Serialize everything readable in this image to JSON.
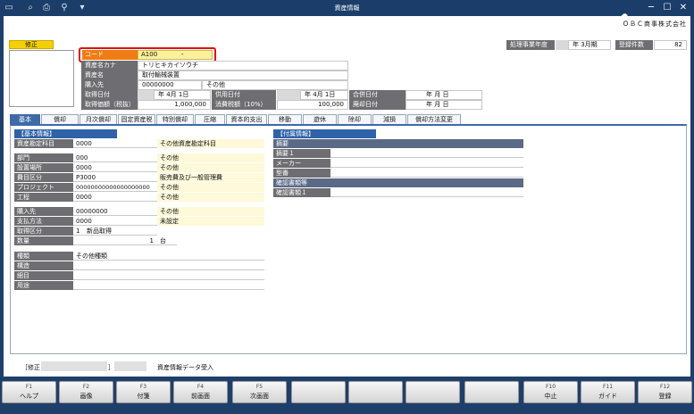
{
  "window": {
    "title": "資産情報"
  },
  "company": "ＯＢＣ商事株式会社",
  "edit_mode": "修正",
  "period": {
    "label": "処理事業年度",
    "value": "年  3月期"
  },
  "registered_count": {
    "label": "登録件数",
    "value": "82"
  },
  "header_fields": {
    "code_label": "コード",
    "code_value": "A100",
    "code_dash": "-",
    "kana_label": "資産名カナ",
    "kana_value": "トリヒキカイソウチ",
    "name_label": "資産名",
    "name_value": "取付輸械装置",
    "purchase_label": "購入先",
    "purchase_code": "00000000",
    "purchase_name": "その他",
    "acq_date_label": "取得日付",
    "acq_date_value": "年  4月  1日",
    "use_date_label": "供用日付",
    "use_date_value": "年  4月  1日",
    "merge_date_label": "合併日付",
    "merge_date_value": "年    月    日",
    "acq_price_label": "取得価額（税抜）",
    "acq_price_value": "1,000,000",
    "tax_label": "消費税額（10%）",
    "tax_value": "100,000",
    "dispose_date_label": "廃却日付",
    "dispose_date_value": "年    月    日"
  },
  "tabs": [
    "基本",
    "償却",
    "月次償却",
    "固定資産税",
    "特別償却",
    "圧縮",
    "資本的支出",
    "移動",
    "遊休",
    "除却",
    "減損",
    "償却方法変更"
  ],
  "basic_info": {
    "header": "【基本情報】",
    "account_label": "資産勘定科目",
    "account_code": "0000",
    "account_name": "その他資産勘定科目",
    "dept_label": "部門",
    "dept_code": "000",
    "dept_name": "その他",
    "place_label": "設置場所",
    "place_code": "0000",
    "place_name": "その他",
    "cost_label": "費目区分",
    "cost_code": "P3000",
    "cost_name": "販売費及び一般管理費",
    "project_label": "プロジェクト",
    "project_code": "00000000000000000000",
    "project_name": "その他",
    "process_label": "工程",
    "process_code": "0000",
    "process_name": "その他",
    "vendor_label": "購入先",
    "vendor_code": "00000000",
    "vendor_name": "その他",
    "payment_label": "支払方法",
    "payment_code": "0000",
    "payment_name": "未設定",
    "acqtype_label": "取得区分",
    "acqtype_code": "1",
    "acqtype_name": "新品取得",
    "qty_label": "数量",
    "qty_value": "1",
    "qty_unit": "台",
    "kind_label": "種類",
    "kind_value": "その他種類",
    "struct_label": "構造",
    "detail_label": "細目",
    "usage_label": "用途"
  },
  "extra_info": {
    "header": "【付属情報】",
    "summary_label": "摘要",
    "summary1_label": "摘要１",
    "maker_label": "メーカー",
    "model_label": "型番",
    "doc_label": "確認書類等",
    "doc1_label": "確認書類１"
  },
  "status_bar": {
    "mode": "［修正",
    "bracket": "］",
    "message": "資産情報データ受入"
  },
  "fkeys": [
    {
      "fn": "F1",
      "label": "ヘルプ"
    },
    {
      "fn": "F2",
      "label": "画像"
    },
    {
      "fn": "F3",
      "label": "付箋"
    },
    {
      "fn": "F4",
      "label": "前画面"
    },
    {
      "fn": "F5",
      "label": "次画面"
    },
    {
      "fn": "",
      "label": ""
    },
    {
      "fn": "",
      "label": ""
    },
    {
      "fn": "",
      "label": ""
    },
    {
      "fn": "",
      "label": ""
    },
    {
      "fn": "F10",
      "label": "中止"
    },
    {
      "fn": "F11",
      "label": "ガイド"
    },
    {
      "fn": "F12",
      "label": "登録"
    }
  ],
  "colors": {
    "titlebar": "#1b3d6a",
    "tab_active": "#3e6aa8",
    "highlight_border": "#e01010",
    "code_label_bg": "#ee7d14"
  }
}
